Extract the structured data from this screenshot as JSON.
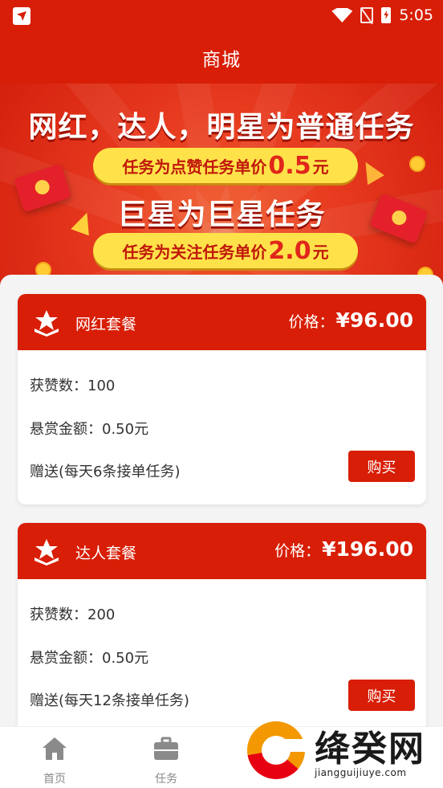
{
  "status_bar": {
    "time": "5:05"
  },
  "header": {
    "title": "商城"
  },
  "banner": {
    "line1": "网红，达人，明星为普通任务",
    "pill1": {
      "prefix": "任务为点赞任务单价",
      "value": "0.5",
      "suffix": "元"
    },
    "line2": "巨星为巨星任务",
    "pill2": {
      "prefix": "任务为关注任务单价",
      "value": "2.0",
      "suffix": "元"
    }
  },
  "packages": [
    {
      "name": "网红套餐",
      "price_label": "价格：",
      "price": "¥96.00",
      "likes": "获赞数：100",
      "reward": "悬赏金额：0.50元",
      "gift": "赠送(每天6条接单任务)",
      "buy_label": "购买"
    },
    {
      "name": "达人套餐",
      "price_label": "价格：",
      "price": "¥196.00",
      "likes": "获赞数：200",
      "reward": "悬赏金额：0.50元",
      "gift": "赠送(每天12条接单任务)",
      "buy_label": "购买"
    }
  ],
  "tabbar": {
    "items": [
      {
        "label": "首页",
        "icon": "home-icon"
      },
      {
        "label": "任务",
        "icon": "briefcase-icon"
      }
    ]
  },
  "watermark": {
    "text": "绛癸网",
    "url": "jiangguijiuye.com"
  },
  "colors": {
    "primary": "#d81e06",
    "banner_yellow": "#ffe24a"
  }
}
